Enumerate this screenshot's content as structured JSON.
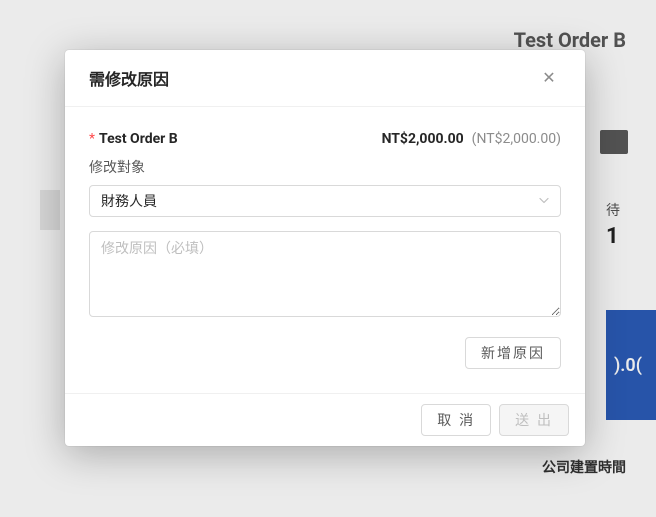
{
  "background": {
    "header_title": "Test Order B",
    "side_label": "待",
    "side_value": "1",
    "blue_text": ").0(",
    "footer_text": "公司建置時間"
  },
  "modal": {
    "title": "需修改原因",
    "close_icon": "✕",
    "order": {
      "required_mark": "*",
      "name": "Test Order B",
      "amount_main": "NT$2,000.00",
      "amount_sub": "(NT$2,000.00)"
    },
    "target": {
      "label": "修改對象",
      "selected": "財務人員"
    },
    "reason": {
      "placeholder": "修改原因（必填）"
    },
    "add_reason_button": "新增原因",
    "footer": {
      "cancel": "取 消",
      "submit": "送 出"
    }
  }
}
